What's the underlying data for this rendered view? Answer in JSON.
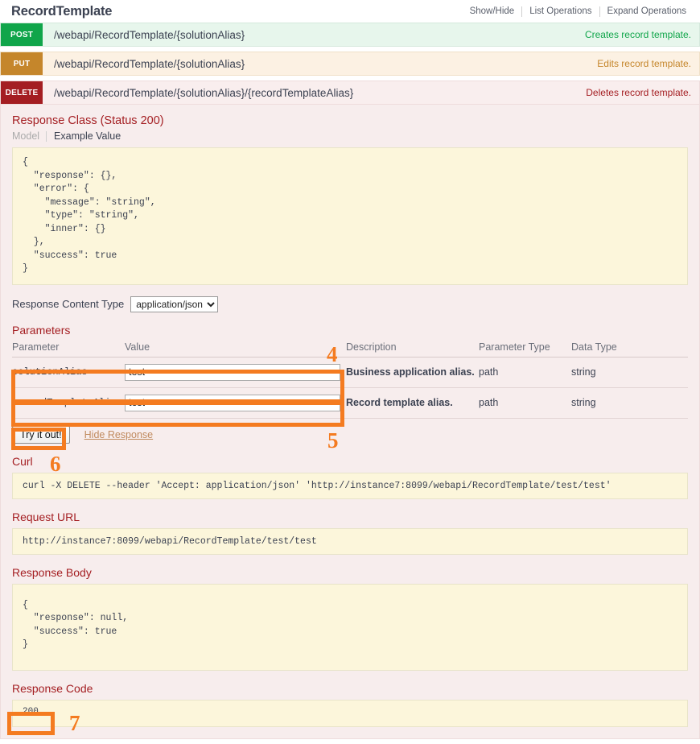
{
  "header": {
    "title": "RecordTemplate",
    "links": [
      "Show/Hide",
      "List Operations",
      "Expand Operations"
    ]
  },
  "operations": [
    {
      "method": "POST",
      "path": "/webapi/RecordTemplate/{solutionAlias}",
      "summary": "Creates record template.",
      "color": "#10a54a"
    },
    {
      "method": "PUT",
      "path": "/webapi/RecordTemplate/{solutionAlias}",
      "summary": "Edits record template.",
      "color": "#c5862b"
    },
    {
      "method": "DELETE",
      "path": "/webapi/RecordTemplate/{solutionAlias}/{recordTemplateAlias}",
      "summary": "Deletes record template.",
      "color": "#a41e22"
    }
  ],
  "detail": {
    "response_class_title": "Response Class (Status 200)",
    "model_tab": "Model",
    "example_tab": "Example Value",
    "example_value": "{\n  \"response\": {},\n  \"error\": {\n    \"message\": \"string\",\n    \"type\": \"string\",\n    \"inner\": {}\n  },\n  \"success\": true\n}",
    "response_content_type_label": "Response Content Type",
    "response_content_type_value": "application/json",
    "response_content_type_options": [
      "application/json"
    ],
    "parameters_title": "Parameters",
    "param_columns": [
      "Parameter",
      "Value",
      "Description",
      "Parameter Type",
      "Data Type"
    ],
    "parameters": [
      {
        "name": "solutionAlias",
        "value": "test",
        "description": "Business application alias.",
        "param_type": "path",
        "data_type": "string"
      },
      {
        "name": "recordTemplateAlias",
        "value": "test",
        "description": "Record template alias.",
        "param_type": "path",
        "data_type": "string"
      }
    ],
    "try_it_out_label": "Try it out!",
    "hide_response_label": "Hide Response",
    "curl_title": "Curl",
    "curl_value": "curl -X DELETE --header 'Accept: application/json' 'http://instance7:8099/webapi/RecordTemplate/test/test'",
    "request_url_title": "Request URL",
    "request_url_value": "http://instance7:8099/webapi/RecordTemplate/test/test",
    "response_body_title": "Response Body",
    "response_body_value": "{\n  \"response\": null,\n  \"success\": true\n}",
    "response_code_title": "Response Code",
    "response_code_value": "200"
  },
  "annotations": {
    "accent_color": "#f47b20",
    "markers": [
      {
        "label": "4"
      },
      {
        "label": "5"
      },
      {
        "label": "6"
      },
      {
        "label": "7"
      }
    ]
  }
}
